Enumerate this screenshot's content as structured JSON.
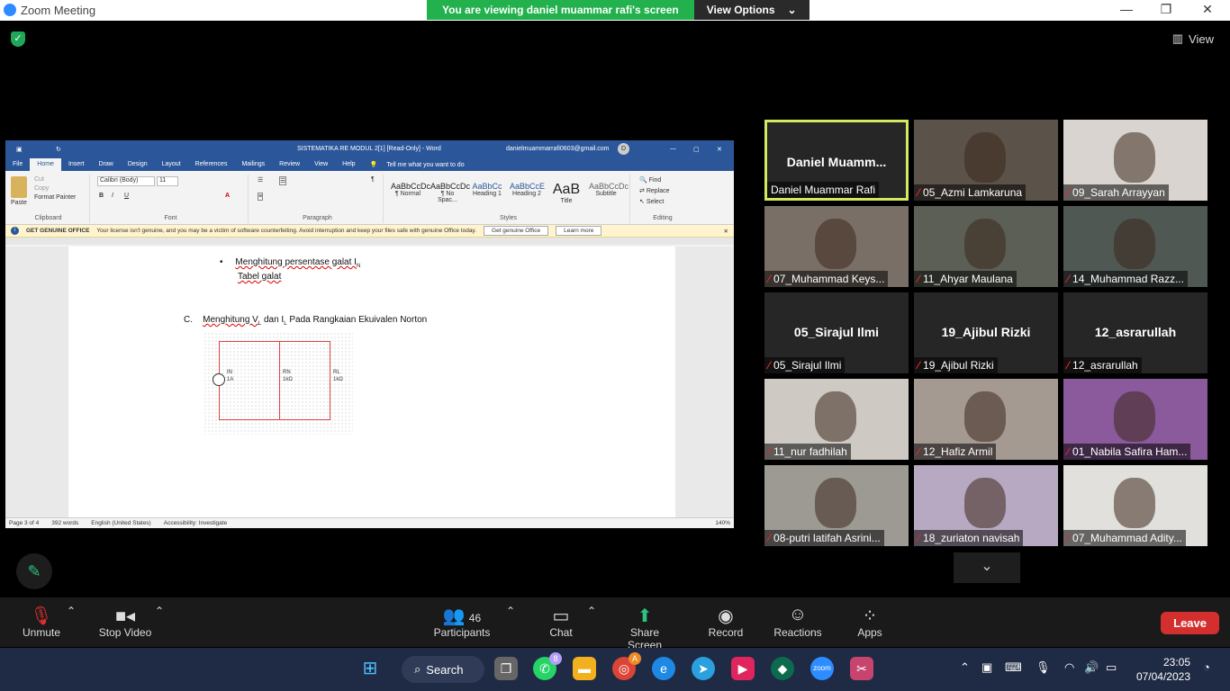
{
  "titlebar": {
    "title": "Zoom Meeting",
    "minimize": "—",
    "maximize": "❐",
    "close": "✕"
  },
  "banner": {
    "message": "You are viewing daniel muammar rafi's screen",
    "options_label": "View Options"
  },
  "view_label": "View",
  "word": {
    "title": "SISTEMATIKA RE MODUL 2[1] [Read-Only]  -  Word",
    "account": "danielmuammarrafi0603@gmail.com",
    "avatar": "D",
    "tabs": [
      "File",
      "Home",
      "Insert",
      "Draw",
      "Design",
      "Layout",
      "References",
      "Mailings",
      "Review",
      "View",
      "Help"
    ],
    "tell_me": "Tell me what you want to do",
    "clipboard": {
      "paste": "Paste",
      "cut": "Cut",
      "copy": "Copy",
      "format_painter": "Format Painter",
      "label": "Clipboard"
    },
    "font": {
      "family": "Calibri (Body)",
      "size": "11",
      "label": "Font"
    },
    "paragraph_label": "Paragraph",
    "styles": [
      {
        "sample": "AaBbCcDc",
        "name": "¶ Normal"
      },
      {
        "sample": "AaBbCcDc",
        "name": "¶ No Spac..."
      },
      {
        "sample": "AaBbCc",
        "name": "Heading 1"
      },
      {
        "sample": "AaBbCcE",
        "name": "Heading 2"
      },
      {
        "sample": "AaB",
        "name": "Title"
      },
      {
        "sample": "AaBbCcDc",
        "name": "Subtitle"
      }
    ],
    "styles_label": "Styles",
    "editing": {
      "find": "Find",
      "replace": "Replace",
      "select": "Select",
      "label": "Editing"
    },
    "infobar": {
      "title": "GET GENUINE OFFICE",
      "message": "Your license isn't genuine, and you may be a victim of software counterfeiting. Avoid interruption and keep your files safe with genuine Office today.",
      "btn1": "Get genuine Office",
      "btn2": "Learn more"
    },
    "doc": {
      "bullet_line": "Menghitung persentase galat I",
      "bullet_sub": "N",
      "table_line": "Tabel galat",
      "section_letter": "C.",
      "section_a": "Menghitung V",
      "section_sub1": "L",
      "section_b": " dan I",
      "section_sub2": "L",
      "section_c": " Pada Rangkaian Ekuivalen Norton",
      "circuit_in": "IN",
      "circuit_in_val": "1A",
      "circuit_rn": "RN",
      "circuit_rn_val": "1kΩ",
      "circuit_rl": "RL",
      "circuit_rl_val": "1kΩ"
    },
    "status": {
      "page": "Page 3 of 4",
      "words": "392 words",
      "language": "English (United States)",
      "accessibility": "Accessibility: Investigate",
      "zoom": "140%"
    }
  },
  "gallery": [
    {
      "name": "Daniel Muammar Rafi",
      "big": "Daniel  Muamm...",
      "muted": false,
      "video": false,
      "active": true
    },
    {
      "name": "05_Azmi Lamkaruna",
      "muted": true,
      "video": true,
      "bg": "#5b5249"
    },
    {
      "name": "09_Sarah Arrayyan",
      "muted": true,
      "video": true,
      "bg": "#d9d4cf"
    },
    {
      "name": "07_Muhammad Keys...",
      "muted": true,
      "video": true,
      "bg": "#7a6f66"
    },
    {
      "name": "11_Ahyar Maulana",
      "muted": true,
      "video": true,
      "bg": "#5c5f55"
    },
    {
      "name": "14_Muhammad Razz...",
      "muted": true,
      "video": true,
      "bg": "#4f5852"
    },
    {
      "name": "05_Sirajul Ilmi",
      "big": "05_Sirajul Ilmi",
      "muted": true,
      "video": false
    },
    {
      "name": "19_Ajibul Rizki",
      "big": "19_Ajibul Rizki",
      "muted": true,
      "video": false
    },
    {
      "name": "12_asrarullah",
      "big": "12_asrarullah",
      "muted": true,
      "video": false
    },
    {
      "name": "11_nur fadhilah",
      "muted": true,
      "video": true,
      "bg": "#cfc9c4"
    },
    {
      "name": "12_Hafiz Armil",
      "muted": true,
      "video": true,
      "bg": "#a49a92"
    },
    {
      "name": "01_Nabila Safira Ham...",
      "muted": true,
      "video": true,
      "bg": "#8a5a9c"
    },
    {
      "name": "08-putri latifah Asrini...",
      "muted": true,
      "video": true,
      "bg": "#9d9a94"
    },
    {
      "name": "18_zuriaton navisah",
      "muted": true,
      "video": true,
      "bg": "#b8a9c2"
    },
    {
      "name": "07_Muhammad Adity...",
      "muted": true,
      "video": true,
      "bg": "#e2e0dc"
    }
  ],
  "controls": {
    "unmute": "Unmute",
    "stop_video": "Stop Video",
    "participants": "Participants",
    "participants_count": "46",
    "chat": "Chat",
    "share_screen": "Share Screen",
    "record": "Record",
    "reactions": "Reactions",
    "apps": "Apps",
    "leave": "Leave"
  },
  "taskbar": {
    "search": "Search",
    "whatsapp_badge": "8",
    "chrome_badge": "A",
    "time": "23:05",
    "date": "07/04/2023"
  },
  "colors": {
    "zoom_green": "#22b14c",
    "word_blue": "#2b579a",
    "leave_red": "#d32f2f",
    "active_tile": "#d6e85e"
  }
}
